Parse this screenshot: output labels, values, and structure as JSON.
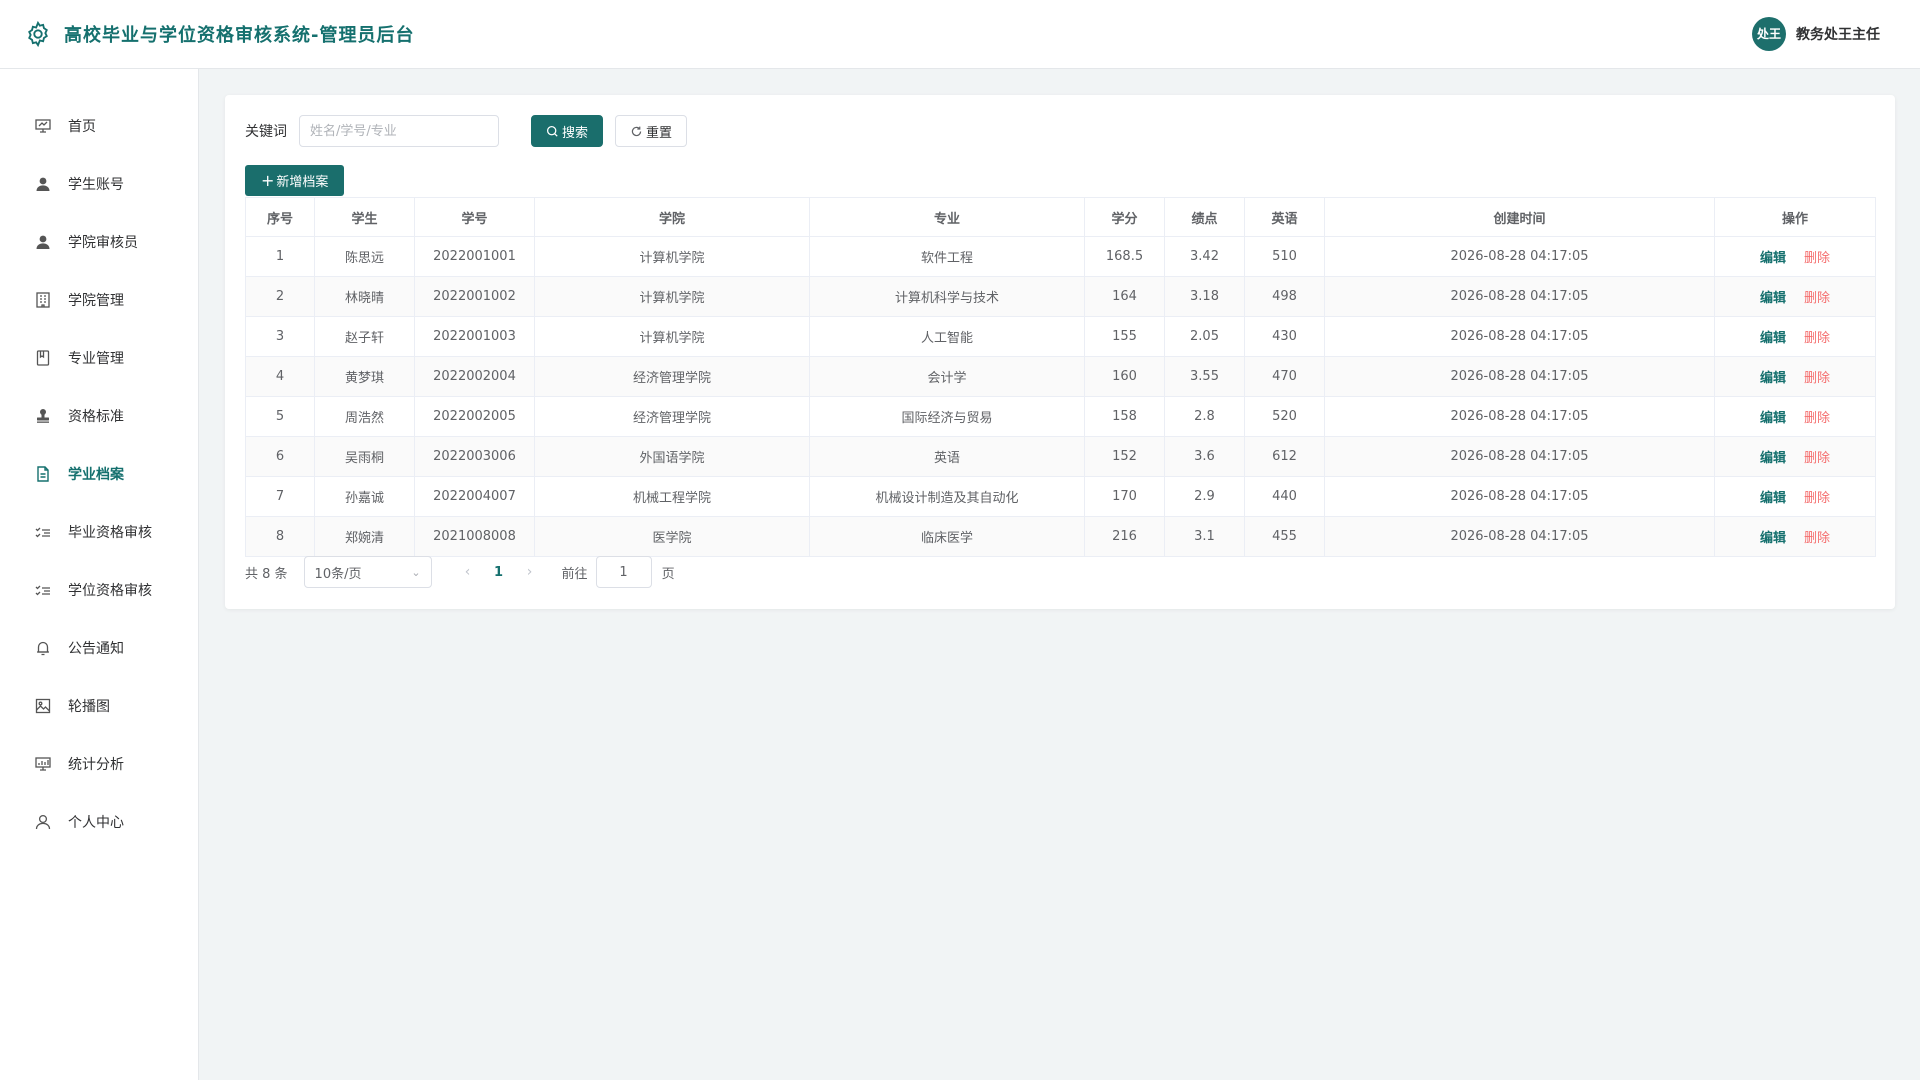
{
  "header": {
    "title": "高校毕业与学位资格审核系统-管理员后台",
    "user_name": "教务处王主任",
    "avatar_text": "处王"
  },
  "colors": {
    "brand": "#15706e",
    "primary_button": "#1a6e6c",
    "danger": "#f56c6c"
  },
  "sidebar": {
    "items": [
      {
        "label": "首页",
        "icon": "presentation-icon",
        "active": false
      },
      {
        "label": "学生账号",
        "icon": "user-icon",
        "active": false
      },
      {
        "label": "学院审核员",
        "icon": "user-icon",
        "active": false
      },
      {
        "label": "学院管理",
        "icon": "building-icon",
        "active": false
      },
      {
        "label": "专业管理",
        "icon": "book-icon",
        "active": false
      },
      {
        "label": "资格标准",
        "icon": "stamp-icon",
        "active": false
      },
      {
        "label": "学业档案",
        "icon": "document-icon",
        "active": true
      },
      {
        "label": "毕业资格审核",
        "icon": "checklist-icon",
        "active": false
      },
      {
        "label": "学位资格审核",
        "icon": "checklist-icon",
        "active": false
      },
      {
        "label": "公告通知",
        "icon": "bell-icon",
        "active": false
      },
      {
        "label": "轮播图",
        "icon": "image-icon",
        "active": false
      },
      {
        "label": "统计分析",
        "icon": "chart-board-icon",
        "active": false
      },
      {
        "label": "个人中心",
        "icon": "person-outline-icon",
        "active": false
      }
    ]
  },
  "search": {
    "label": "关键词",
    "placeholder": "姓名/学号/专业",
    "value": "",
    "search_button": "搜索",
    "reset_button": "重置"
  },
  "add_button": "新增档案",
  "table": {
    "columns": [
      "序号",
      "学生",
      "学号",
      "学院",
      "专业",
      "学分",
      "绩点",
      "英语",
      "创建时间",
      "操作"
    ],
    "edit_label": "编辑",
    "delete_label": "删除",
    "rows": [
      {
        "idx": "1",
        "name": "陈思远",
        "sid": "2022001001",
        "college": "计算机学院",
        "major": "软件工程",
        "credits": "168.5",
        "gpa": "3.42",
        "english": "510",
        "created": "2026-08-28 04:17:05"
      },
      {
        "idx": "2",
        "name": "林晓晴",
        "sid": "2022001002",
        "college": "计算机学院",
        "major": "计算机科学与技术",
        "credits": "164",
        "gpa": "3.18",
        "english": "498",
        "created": "2026-08-28 04:17:05"
      },
      {
        "idx": "3",
        "name": "赵子轩",
        "sid": "2022001003",
        "college": "计算机学院",
        "major": "人工智能",
        "credits": "155",
        "gpa": "2.05",
        "english": "430",
        "created": "2026-08-28 04:17:05"
      },
      {
        "idx": "4",
        "name": "黄梦琪",
        "sid": "2022002004",
        "college": "经济管理学院",
        "major": "会计学",
        "credits": "160",
        "gpa": "3.55",
        "english": "470",
        "created": "2026-08-28 04:17:05"
      },
      {
        "idx": "5",
        "name": "周浩然",
        "sid": "2022002005",
        "college": "经济管理学院",
        "major": "国际经济与贸易",
        "credits": "158",
        "gpa": "2.8",
        "english": "520",
        "created": "2026-08-28 04:17:05"
      },
      {
        "idx": "6",
        "name": "吴雨桐",
        "sid": "2022003006",
        "college": "外国语学院",
        "major": "英语",
        "credits": "152",
        "gpa": "3.6",
        "english": "612",
        "created": "2026-08-28 04:17:05"
      },
      {
        "idx": "7",
        "name": "孙嘉诚",
        "sid": "2022004007",
        "college": "机械工程学院",
        "major": "机械设计制造及其自动化",
        "credits": "170",
        "gpa": "2.9",
        "english": "440",
        "created": "2026-08-28 04:17:05"
      },
      {
        "idx": "8",
        "name": "郑婉清",
        "sid": "2021008008",
        "college": "医学院",
        "major": "临床医学",
        "credits": "216",
        "gpa": "3.1",
        "english": "455",
        "created": "2026-08-28 04:17:05"
      }
    ]
  },
  "pagination": {
    "total_text": "共 8 条",
    "page_size": "10条/页",
    "current_page": "1",
    "goto_label": "前往",
    "goto_value": "1",
    "page_word": "页"
  }
}
